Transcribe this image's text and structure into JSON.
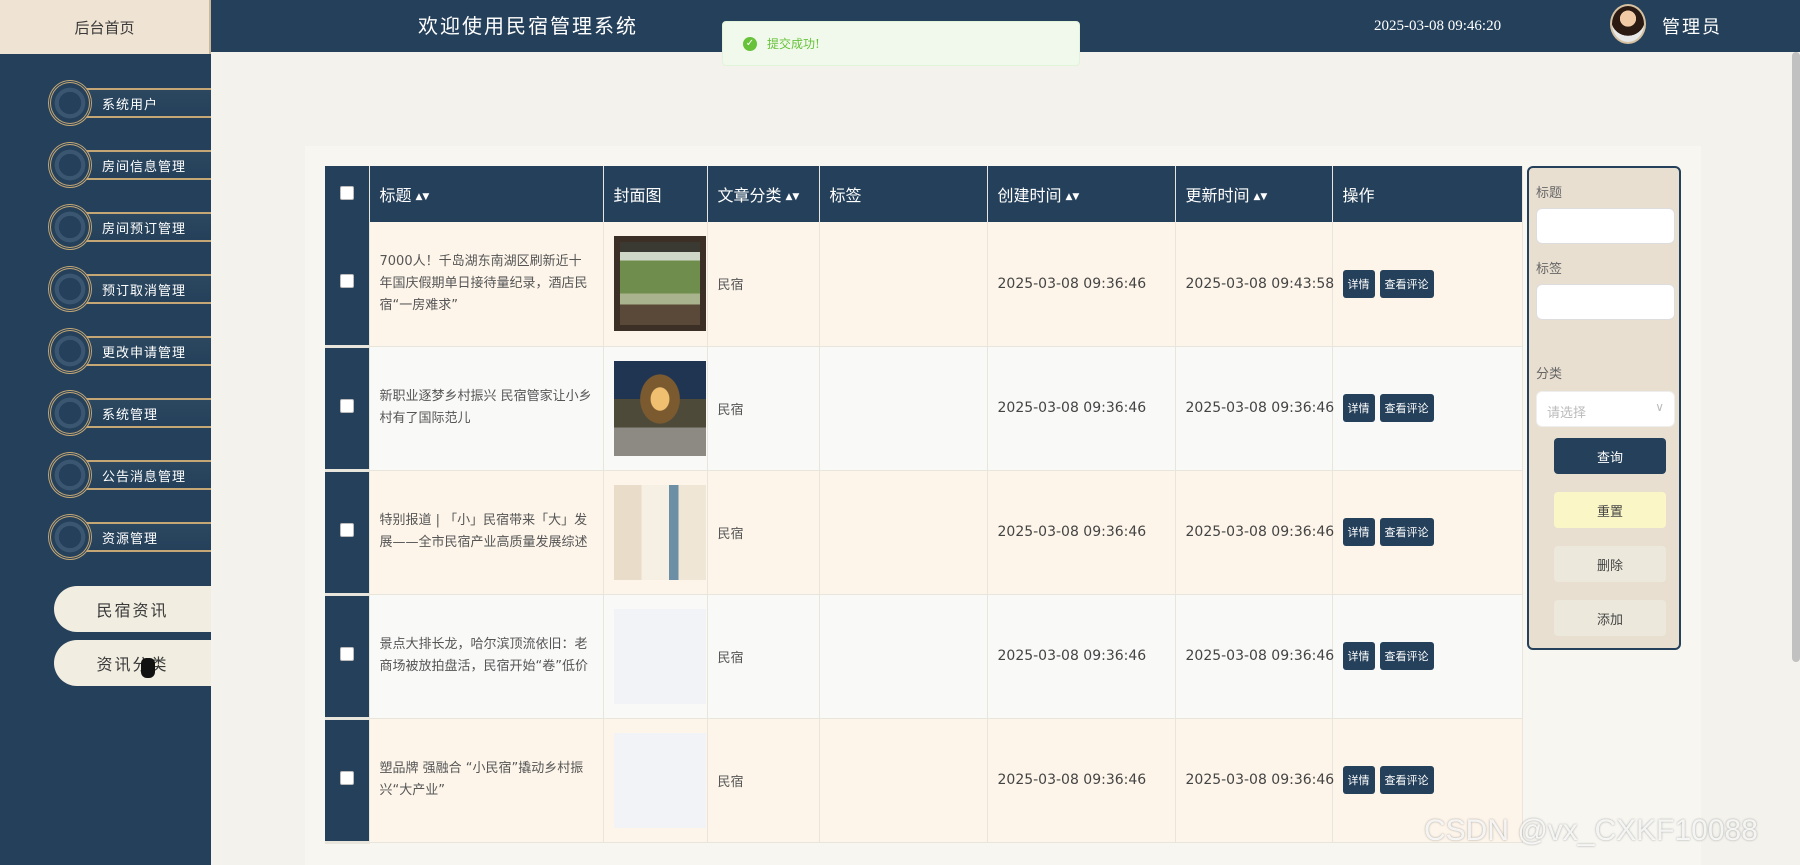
{
  "header": {
    "home_tab": "后台首页",
    "app_title": "欢迎使用民宿管理系统",
    "datetime": "2025-03-08 09:46:20",
    "user_label": "管理员"
  },
  "toast": {
    "message": "提交成功!",
    "icon": "check-icon",
    "color": "#67c23a"
  },
  "sidebar": {
    "items": [
      {
        "label": "系统用户"
      },
      {
        "label": "房间信息管理"
      },
      {
        "label": "房间预订管理"
      },
      {
        "label": "预订取消管理"
      },
      {
        "label": "更改申请管理"
      },
      {
        "label": "系统管理"
      },
      {
        "label": "公告消息管理"
      },
      {
        "label": "资源管理"
      }
    ],
    "submenu": [
      {
        "label": "民宿资讯"
      },
      {
        "label": "资讯分类"
      }
    ]
  },
  "table": {
    "columns": [
      "标题",
      "封面图",
      "文章分类",
      "标签",
      "创建时间",
      "更新时间",
      "操作"
    ],
    "rows": [
      {
        "title": "7000人！千岛湖东南湖区刷新近十年国庆假期单日接待量纪录，酒店民宿“一房难求”",
        "category": "民宿",
        "tag": "",
        "created": "2025-03-08 09:36:46",
        "updated": "2025-03-08 09:43:58"
      },
      {
        "title": "新职业逐梦乡村振兴 民宿管家让小乡村有了国际范儿",
        "category": "民宿",
        "tag": "",
        "created": "2025-03-08 09:36:46",
        "updated": "2025-03-08 09:36:46"
      },
      {
        "title": "特别报道 | 「小」民宿带来「大」发展——全市民宿产业高质量发展综述",
        "category": "民宿",
        "tag": "",
        "created": "2025-03-08 09:36:46",
        "updated": "2025-03-08 09:36:46"
      },
      {
        "title": "景点大排长龙，哈尔滨顶流依旧：老商场被放拍盘活，民宿开始“卷”低价",
        "category": "民宿",
        "tag": "",
        "created": "2025-03-08 09:36:46",
        "updated": "2025-03-08 09:36:46"
      },
      {
        "title": "塑品牌 强融合 “小民宿”撬动乡村振兴“大产业”",
        "category": "民宿",
        "tag": "",
        "created": "2025-03-08 09:36:46",
        "updated": "2025-03-08 09:36:46"
      }
    ],
    "actions": {
      "detail": "详情",
      "comments": "查看评论"
    }
  },
  "search": {
    "title_label": "标题",
    "tag_label": "标签",
    "category_label": "分类",
    "category_placeholder": "请选择",
    "query_btn": "查询",
    "reset_btn": "重置",
    "delete_btn": "删除",
    "add_btn": "添加"
  },
  "watermark": "CSDN @vx_CXKF10088",
  "colors": {
    "primary": "#25405a",
    "accent": "#c4a775",
    "success": "#67c23a"
  }
}
